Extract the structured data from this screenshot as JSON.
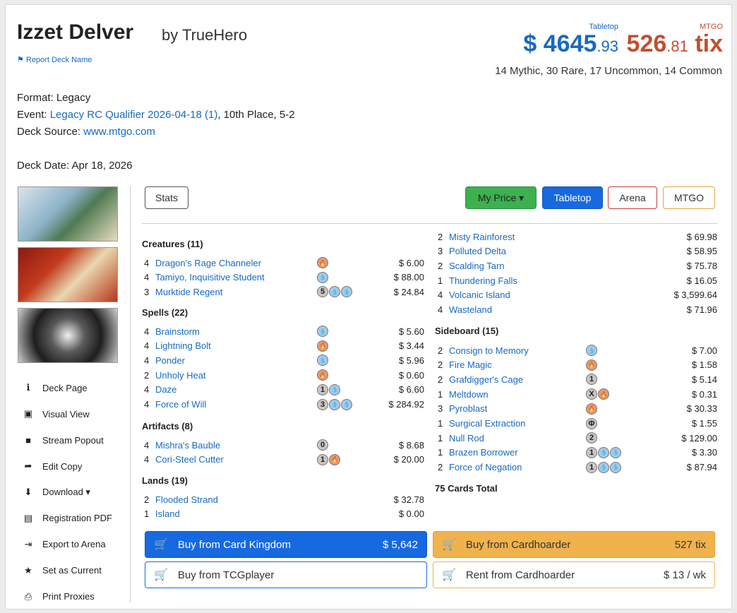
{
  "header": {
    "title": "Izzet Delver",
    "author": "by TrueHero",
    "report_label": "Report Deck Name",
    "tabletop_label": "Tabletop",
    "tabletop_dollars": "$ 4645",
    "tabletop_cents": ".93",
    "mtgo_label": "MTGO",
    "mtgo_whole": "526",
    "mtgo_frac": ".81",
    "mtgo_unit": " tix",
    "rarity": "14 Mythic, 30 Rare, 17 Uncommon, 14 Common"
  },
  "meta": {
    "format": "Format: Legacy",
    "event_prefix": "Event: ",
    "event_link": "Legacy RC Qualifier 2026-04-18 (1)",
    "event_suffix": ", 10th Place, 5-2",
    "source_prefix": "Deck Source: ",
    "source_link": "www.mtgo.com",
    "date": "Deck Date: Apr 18, 2026"
  },
  "sidebar": {
    "items": [
      {
        "label": "Deck Page",
        "icon": "info-icon"
      },
      {
        "label": "Visual View",
        "icon": "image-icon"
      },
      {
        "label": "Stream Popout",
        "icon": "video-icon"
      },
      {
        "label": "Edit Copy",
        "icon": "share-icon"
      },
      {
        "label": "Download ▾",
        "icon": "download-icon"
      },
      {
        "label": "Registration PDF",
        "icon": "pdf-icon"
      },
      {
        "label": "Export to Arena",
        "icon": "export-icon"
      },
      {
        "label": "Set as Current",
        "icon": "star-icon"
      },
      {
        "label": "Print Proxies",
        "icon": "print-icon"
      }
    ]
  },
  "toolbar": {
    "stats": "Stats",
    "my_price": "My Price ▾",
    "tabletop": "Tabletop",
    "arena": "Arena",
    "mtgo": "MTGO"
  },
  "deck": {
    "creatures": {
      "title": "Creatures (11)",
      "cards": [
        {
          "qty": "4",
          "name": "Dragon's Rage Channeler",
          "mana": [
            "r"
          ],
          "price": "$ 6.00"
        },
        {
          "qty": "4",
          "name": "Tamiyo, Inquisitive Student",
          "mana": [
            "u"
          ],
          "price": "$ 88.00"
        },
        {
          "qty": "3",
          "name": "Murktide Regent",
          "mana": [
            "5",
            "u",
            "u"
          ],
          "price": "$ 24.84"
        }
      ]
    },
    "spells": {
      "title": "Spells (22)",
      "cards": [
        {
          "qty": "4",
          "name": "Brainstorm",
          "mana": [
            "u"
          ],
          "price": "$ 5.60"
        },
        {
          "qty": "4",
          "name": "Lightning Bolt",
          "mana": [
            "r"
          ],
          "price": "$ 3.44"
        },
        {
          "qty": "4",
          "name": "Ponder",
          "mana": [
            "u"
          ],
          "price": "$ 5.96"
        },
        {
          "qty": "2",
          "name": "Unholy Heat",
          "mana": [
            "r"
          ],
          "price": "$ 0.60"
        },
        {
          "qty": "4",
          "name": "Daze",
          "mana": [
            "1",
            "u"
          ],
          "price": "$ 6.60"
        },
        {
          "qty": "4",
          "name": "Force of Will",
          "mana": [
            "3",
            "u",
            "u"
          ],
          "price": "$ 284.92"
        }
      ]
    },
    "artifacts": {
      "title": "Artifacts (8)",
      "cards": [
        {
          "qty": "4",
          "name": "Mishra's Bauble",
          "mana": [
            "0"
          ],
          "price": "$ 8.68"
        },
        {
          "qty": "4",
          "name": "Cori-Steel Cutter",
          "mana": [
            "1",
            "r"
          ],
          "price": "$ 20.00"
        }
      ]
    },
    "lands": {
      "title": "Lands (19)",
      "cards": [
        {
          "qty": "2",
          "name": "Flooded Strand",
          "price": "$ 32.78"
        },
        {
          "qty": "1",
          "name": "Island",
          "price": "$ 0.00"
        },
        {
          "qty": "2",
          "name": "Misty Rainforest",
          "price": "$ 69.98"
        },
        {
          "qty": "3",
          "name": "Polluted Delta",
          "price": "$ 58.95"
        },
        {
          "qty": "2",
          "name": "Scalding Tarn",
          "price": "$ 75.78"
        },
        {
          "qty": "1",
          "name": "Thundering Falls",
          "price": "$ 16.05"
        },
        {
          "qty": "4",
          "name": "Volcanic Island",
          "price": "$ 3,599.64"
        },
        {
          "qty": "4",
          "name": "Wasteland",
          "price": "$ 71.96"
        }
      ]
    },
    "sideboard": {
      "title": "Sideboard (15)",
      "cards": [
        {
          "qty": "2",
          "name": "Consign to Memory",
          "mana": [
            "u"
          ],
          "price": "$ 7.00"
        },
        {
          "qty": "2",
          "name": "Fire Magic",
          "mana": [
            "r"
          ],
          "price": "$ 1.58"
        },
        {
          "qty": "2",
          "name": "Grafdigger's Cage",
          "mana": [
            "1"
          ],
          "price": "$ 5.14"
        },
        {
          "qty": "1",
          "name": "Meltdown",
          "mana": [
            "X",
            "r"
          ],
          "price": "$ 0.31"
        },
        {
          "qty": "3",
          "name": "Pyroblast",
          "mana": [
            "r"
          ],
          "price": "$ 30.33"
        },
        {
          "qty": "1",
          "name": "Surgical Extraction",
          "mana": [
            "Φ"
          ],
          "price": "$ 1.55"
        },
        {
          "qty": "1",
          "name": "Null Rod",
          "mana": [
            "2"
          ],
          "price": "$ 129.00"
        },
        {
          "qty": "1",
          "name": "Brazen Borrower",
          "mana": [
            "1",
            "u",
            "u"
          ],
          "price": "$ 3.30"
        },
        {
          "qty": "2",
          "name": "Force of Negation",
          "mana": [
            "1",
            "u",
            "u"
          ],
          "price": "$ 87.94"
        }
      ]
    },
    "total": "75 Cards Total"
  },
  "buy": {
    "ck_label": "Buy from Card Kingdom",
    "ck_price": "$ 5,642",
    "ch_label": "Buy from Cardhoarder",
    "ch_price": "527 tix",
    "tcg_label": "Buy from TCGplayer",
    "rent_label": "Rent from Cardhoarder",
    "rent_price": "$ 13 / wk"
  },
  "colors": {
    "link": "#1769c4",
    "tabletop_price": "#1769c4",
    "mtgo_price": "#c0502f",
    "my_price_btn": "#3db04f",
    "tabletop_btn": "#1769e0",
    "cardhoarder": "#f0b24c"
  }
}
